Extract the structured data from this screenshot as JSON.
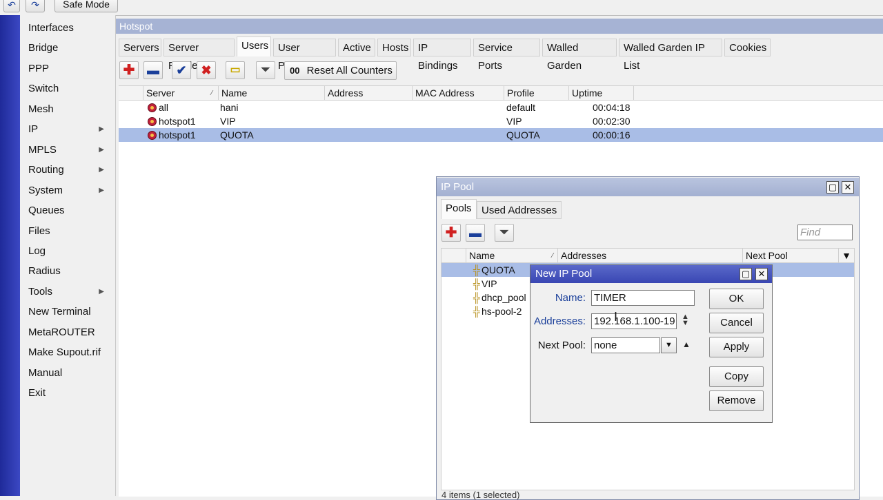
{
  "top": {
    "safe_mode": "Safe Mode",
    "undo_icon": "undo-icon",
    "redo_icon": "redo-icon"
  },
  "sidebar": {
    "items": [
      {
        "label": "Interfaces",
        "submenu": false
      },
      {
        "label": "Bridge",
        "submenu": false
      },
      {
        "label": "PPP",
        "submenu": false
      },
      {
        "label": "Switch",
        "submenu": false
      },
      {
        "label": "Mesh",
        "submenu": false
      },
      {
        "label": "IP",
        "submenu": true
      },
      {
        "label": "MPLS",
        "submenu": true
      },
      {
        "label": "Routing",
        "submenu": true
      },
      {
        "label": "System",
        "submenu": true
      },
      {
        "label": "Queues",
        "submenu": false
      },
      {
        "label": "Files",
        "submenu": false
      },
      {
        "label": "Log",
        "submenu": false
      },
      {
        "label": "Radius",
        "submenu": false
      },
      {
        "label": "Tools",
        "submenu": true
      },
      {
        "label": "New Terminal",
        "submenu": false
      },
      {
        "label": "MetaROUTER",
        "submenu": false
      },
      {
        "label": "Make Supout.rif",
        "submenu": false
      },
      {
        "label": "Manual",
        "submenu": false
      },
      {
        "label": "Exit",
        "submenu": false
      }
    ]
  },
  "hotspot": {
    "title": "Hotspot",
    "tabs": [
      "Servers",
      "Server Profiles",
      "Users",
      "User Profiles",
      "Active",
      "Hosts",
      "IP Bindings",
      "Service Ports",
      "Walled Garden",
      "Walled Garden IP List",
      "Cookies"
    ],
    "active_tab": "Users",
    "reset_counters": "Reset All Counters",
    "reset_prefix": "00",
    "columns": [
      "Server",
      "Name",
      "Address",
      "MAC Address",
      "Profile",
      "Uptime"
    ],
    "rows": [
      {
        "server": "all",
        "name": "hani",
        "address": "",
        "mac": "",
        "profile": "default",
        "uptime": "00:04:18",
        "selected": false
      },
      {
        "server": "hotspot1",
        "name": "VIP",
        "address": "",
        "mac": "",
        "profile": "VIP",
        "uptime": "00:02:30",
        "selected": false
      },
      {
        "server": "hotspot1",
        "name": "QUOTA",
        "address": "",
        "mac": "",
        "profile": "QUOTA",
        "uptime": "00:00:16",
        "selected": true
      }
    ]
  },
  "ippool": {
    "title": "IP Pool",
    "tabs": [
      "Pools",
      "Used Addresses"
    ],
    "active_tab": "Pools",
    "find_placeholder": "Find",
    "columns": [
      "Name",
      "Addresses",
      "Next Pool"
    ],
    "rows": [
      {
        "name": "QUOTA",
        "selected": true
      },
      {
        "name": "VIP",
        "selected": false
      },
      {
        "name": "dhcp_pool",
        "selected": false
      },
      {
        "name": "hs-pool-2",
        "selected": false
      }
    ],
    "status": "4 items (1 selected)"
  },
  "newpool": {
    "title": "New IP Pool",
    "name_label": "Name:",
    "name_value": "TIMER",
    "addresses_label": "Addresses:",
    "addresses_value": "192.168.1.100-19",
    "nextpool_label": "Next Pool:",
    "nextpool_value": "none",
    "buttons": {
      "ok": "OK",
      "cancel": "Cancel",
      "apply": "Apply",
      "copy": "Copy",
      "remove": "Remove"
    }
  },
  "colors": {
    "accent": "#3946b3",
    "selection": "#a9bde6",
    "side_strip": "#2a35a8",
    "add": "#d02020",
    "remove": "#1a3f9a"
  }
}
